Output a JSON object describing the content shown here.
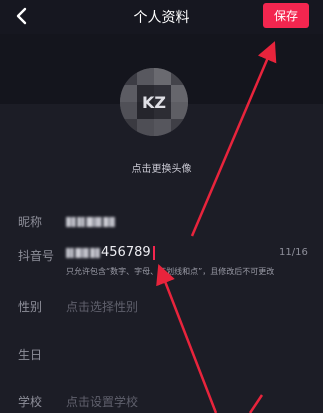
{
  "header": {
    "title": "个人资料",
    "save_label": "保存",
    "back_icon": "chevron-left-icon"
  },
  "avatar": {
    "hint": "点击更换头像",
    "overlay_text": "KZ"
  },
  "fields": {
    "nickname": {
      "label": "昵称"
    },
    "douyin_id": {
      "label": "抖音号",
      "value_visible": "456789",
      "counter": "11/16",
      "hint": "只允许包含“数字、字母、下划线和点”，且修改后不可更改"
    },
    "gender": {
      "label": "性别",
      "placeholder": "点击选择性别"
    },
    "birthday": {
      "label": "生日"
    },
    "school": {
      "label": "学校",
      "placeholder": "点击设置学校"
    }
  },
  "colors": {
    "accent": "#f3264f",
    "background": "#1c1d26",
    "arrow": "#e8243c"
  }
}
